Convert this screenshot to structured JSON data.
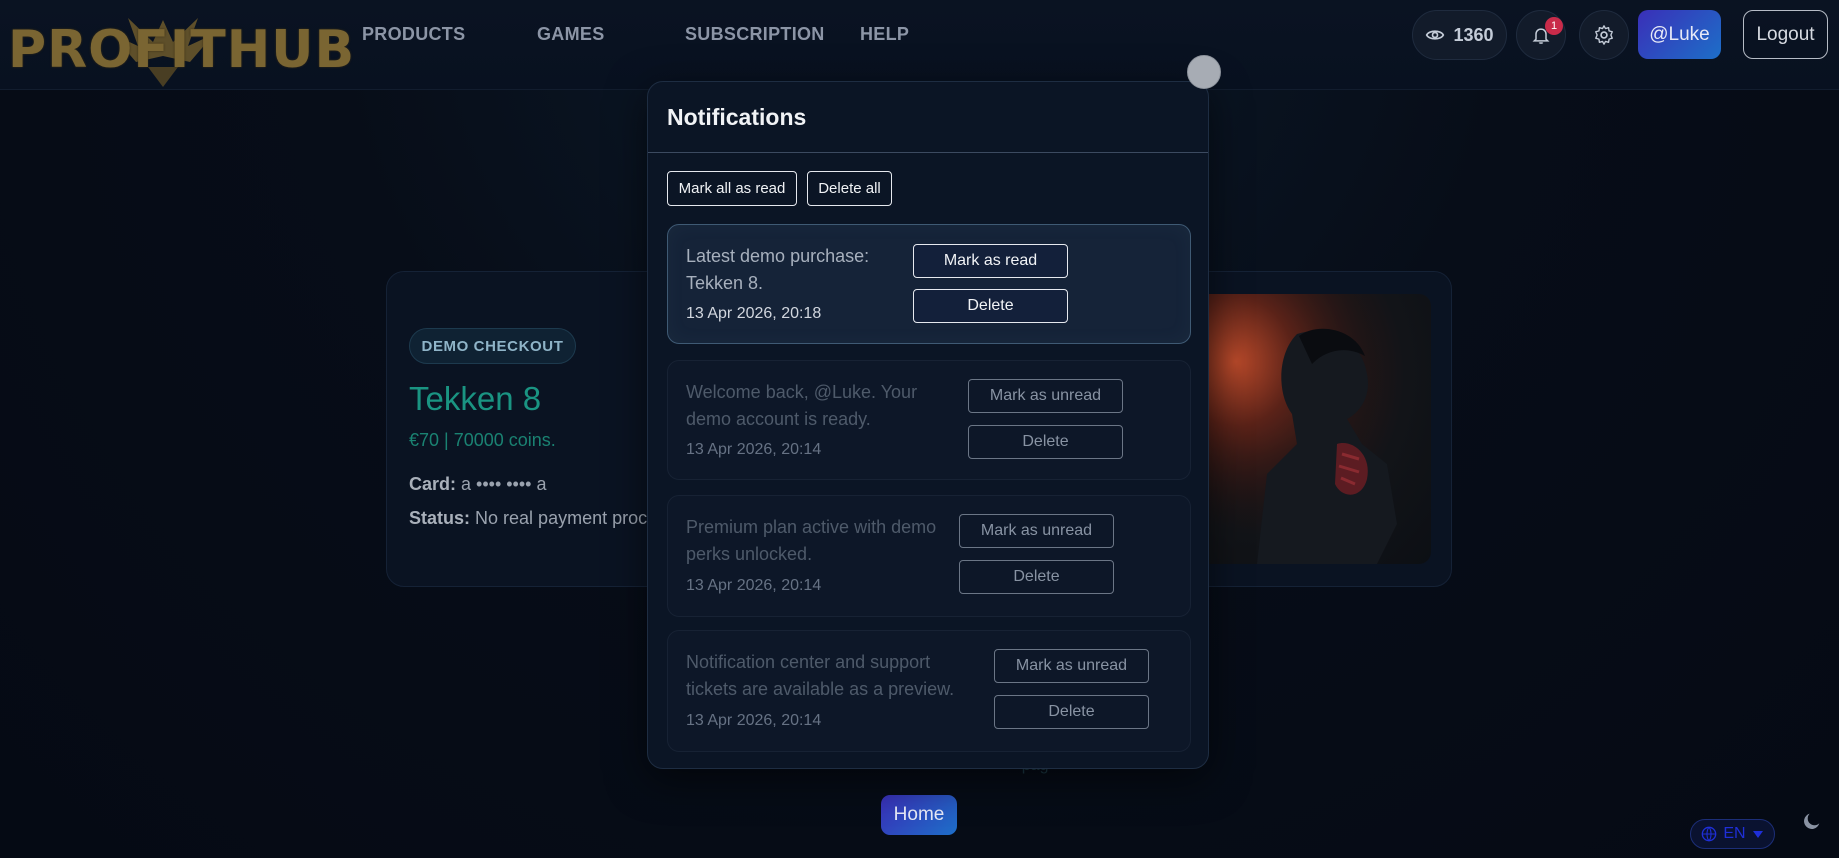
{
  "brand": {
    "logo_text": "PROFITHUB"
  },
  "nav": {
    "items": [
      {
        "label": "PRODUCTS"
      },
      {
        "label": "GAMES"
      },
      {
        "label": "SUBSCRIPTION"
      },
      {
        "label": "HELP"
      }
    ]
  },
  "header": {
    "coins": "1360",
    "coins_icon": "eye-icon",
    "notification_count": "1",
    "user_label": "@Luke",
    "logout_label": "Logout"
  },
  "checkout": {
    "badge": "DEMO CHECKOUT",
    "title": "Tekken 8",
    "price": "€70 | 70000 coins.",
    "card_label": "Card:",
    "card_value": "a •••• •••• a",
    "status_label": "Status:",
    "status_value": "No real payment proc"
  },
  "home_label": "Home",
  "language": {
    "code": "EN"
  },
  "notifications": {
    "title": "Notifications",
    "mark_all_label": "Mark all as read",
    "delete_all_label": "Delete all",
    "items": [
      {
        "message_line1": "Latest demo purchase:",
        "message_line2": "Tekken 8.",
        "time": "13 Apr 2026, 20:18",
        "toggle_label": "Mark as read",
        "delete_label": "Delete",
        "unread": true
      },
      {
        "message_line1": "Welcome back, @Luke. Your",
        "message_line2": "demo account is ready.",
        "time": "13 Apr 2026, 20:14",
        "toggle_label": "Mark as unread",
        "delete_label": "Delete",
        "unread": false
      },
      {
        "message_line1": "Premium plan active with demo",
        "message_line2": "perks unlocked.",
        "time": "13 Apr 2026, 20:14",
        "toggle_label": "Mark as unread",
        "delete_label": "Delete",
        "unread": false
      },
      {
        "message_line1": "Notification center and support",
        "message_line2": "tickets are available as a preview.",
        "time": "13 Apr 2026, 20:14",
        "toggle_label": "Mark as unread",
        "delete_label": "Delete",
        "unread": false
      }
    ]
  },
  "colors": {
    "accent_teal": "#1a9482",
    "gradient_start": "#3a2fb8",
    "gradient_end": "#1d6fc8",
    "badge_red": "#c92b4a"
  }
}
